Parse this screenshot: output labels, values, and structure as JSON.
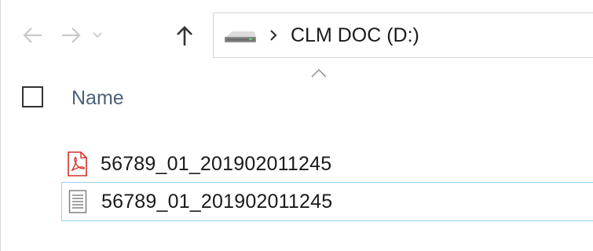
{
  "navigation": {
    "back_icon": "arrow-left-icon",
    "forward_icon": "arrow-right-icon",
    "recent_icon": "chevron-down-icon",
    "up_icon": "arrow-up-icon",
    "breadcrumb": {
      "drive_icon": "drive-icon",
      "separator_icon": "chevron-right-icon",
      "location": "CLM DOC (D:)"
    }
  },
  "file_list": {
    "sort_icon": "chevron-up-icon",
    "column_header": "Name",
    "files": [
      {
        "name": "56789_01_201902011245",
        "icon": "pdf-file-icon",
        "selected": false
      },
      {
        "name": "56789_01_201902011245",
        "icon": "text-file-icon",
        "selected": true
      }
    ]
  },
  "colors": {
    "column_header_text": "#4c607a",
    "selection_border": "#99d1f1",
    "pdf_icon_red": "#d0312d",
    "disabled_arrow": "#c8c8c8"
  }
}
